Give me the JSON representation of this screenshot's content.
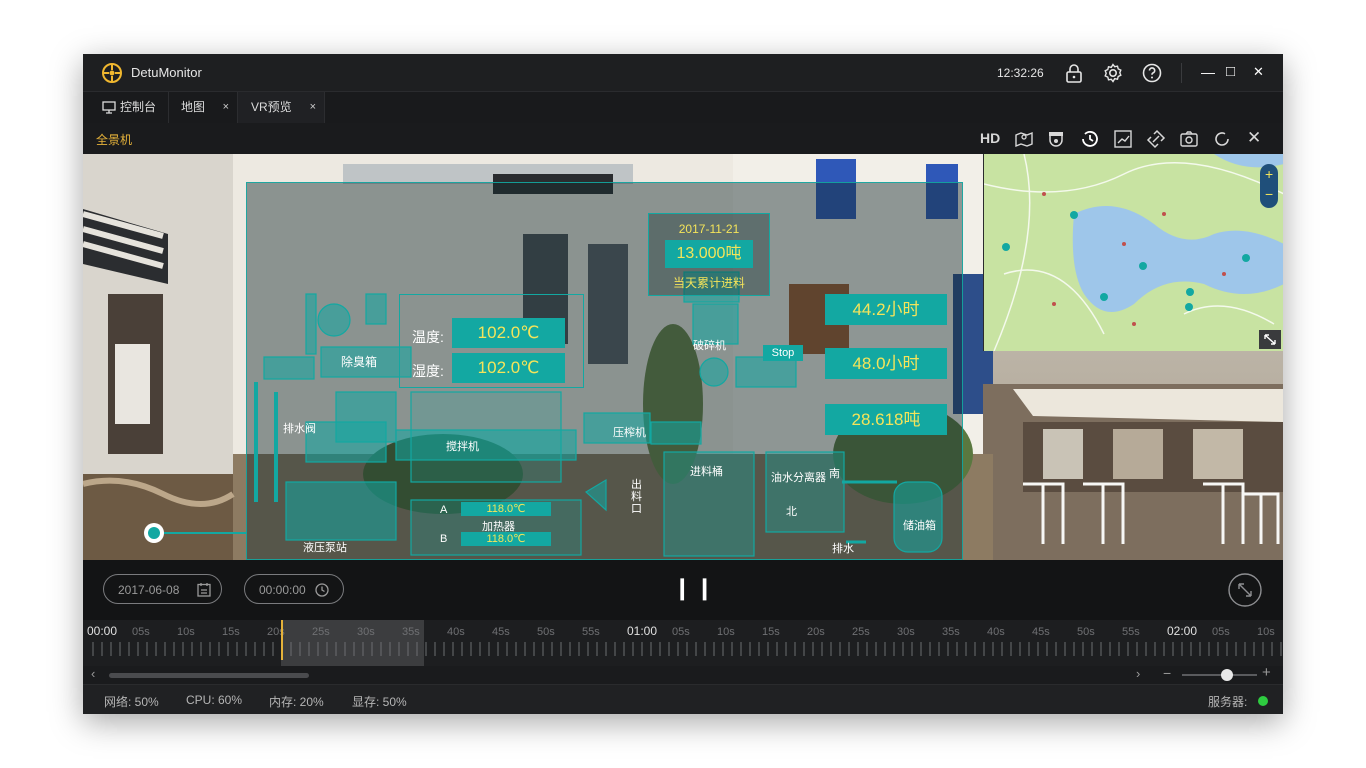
{
  "app": {
    "title": "DetuMonitor",
    "clock": "12:32:26"
  },
  "titlebar_icons": [
    "lock-icon",
    "settings-icon",
    "help-icon"
  ],
  "window_controls": {
    "minimize": "—",
    "maximize": "□",
    "close": "✕"
  },
  "tabs": [
    {
      "label": "控制台",
      "icon": "monitor-icon",
      "closable": false
    },
    {
      "label": "地图",
      "closable": true
    },
    {
      "label": "VR预览",
      "closable": true,
      "active": true
    }
  ],
  "tab_close": "×",
  "toolbar": {
    "camera_label": "全景机",
    "hd_label": "HD",
    "close": "✕"
  },
  "overlay": {
    "date": "2017-11-21",
    "daily_amount": "13.000吨",
    "daily_label": "当天累计进料",
    "hours1": "44.2小时",
    "hours2": "48.0小时",
    "tonnage": "28.618吨",
    "stop": "Stop",
    "temp_label": "温度:",
    "temp_value": "102.0℃",
    "humid_label": "湿度:",
    "humid_value": "102.0℃",
    "heater_a_label": "A",
    "heater_a_value": "118.0℃",
    "heater_b_label": "B",
    "heater_b_value": "118.0℃",
    "heater_label": "加热器",
    "deodorizer": "除臭箱",
    "drain_valve": "排水阀",
    "mixer": "搅拌机",
    "hydraulic": "液压泵站",
    "crusher": "破碎机",
    "press": "压榨机",
    "outlet": "出料口",
    "feed_bucket": "进料桶",
    "separator": "油水分离器",
    "south": "南",
    "north": "北",
    "drain": "排水",
    "oil_tank": "储油箱"
  },
  "minimap": {
    "zoom_in": "+",
    "zoom_out": "−"
  },
  "controls": {
    "date": "2017-06-08",
    "time": "00:00:00",
    "pause": "❙❙"
  },
  "timeline": {
    "labels": [
      "00:00",
      "05s",
      "10s",
      "15s",
      "20s",
      "25s",
      "30s",
      "35s",
      "40s",
      "45s",
      "50s",
      "55s",
      "01:00",
      "05s",
      "10s",
      "15s",
      "20s",
      "25s",
      "30s",
      "35s",
      "40s",
      "45s",
      "50s",
      "55s",
      "02:00",
      "05s",
      "10s"
    ],
    "major": [
      "00:00",
      "01:00",
      "02:00"
    ]
  },
  "scroll": {
    "left": "‹",
    "right": "›",
    "minus": "−",
    "plus": "+",
    "zoom_level": 0.6
  },
  "status": {
    "network": "网络: 50%",
    "cpu": "CPU: 60%",
    "memory": "内存: 20%",
    "vram": "显存: 50%",
    "server": "服务器:"
  },
  "colors": {
    "accent": "#13a8a2",
    "highlight": "#f4e45a",
    "orange": "#e5b23a",
    "server_ok": "#2ecc40"
  }
}
